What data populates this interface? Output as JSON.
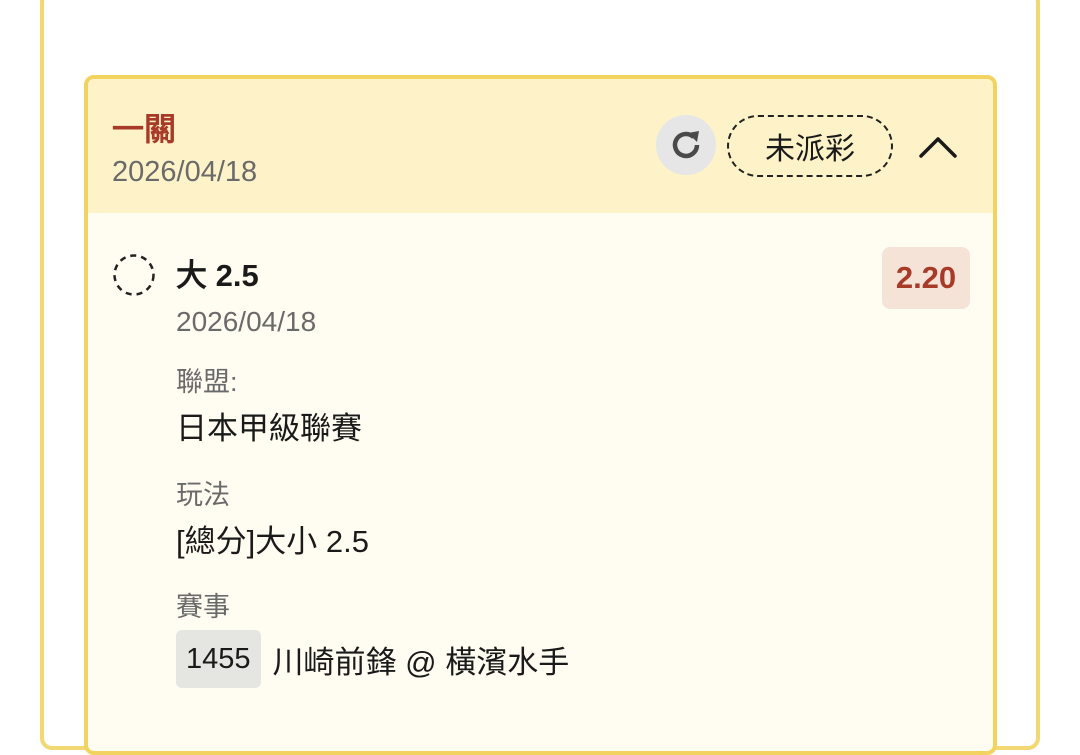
{
  "bet": {
    "type": "一關",
    "date": "2026/04/18",
    "status": "未派彩",
    "refresh_icon": "refresh-icon",
    "collapse_icon": "chevron-up-icon"
  },
  "selection": {
    "name": "大 2.5",
    "date": "2026/04/18",
    "odds": "2.20",
    "radio_icon": "dashed-circle-icon"
  },
  "details": {
    "league_label": "聯盟:",
    "league_value": "日本甲級聯賽",
    "play_label": "玩法",
    "play_value": "[總分]大小 2.5",
    "match_label": "賽事",
    "match_id": "1455",
    "match_teams": "川崎前鋒 @ 橫濱水手"
  },
  "colors": {
    "accent_red": "#a83a28",
    "card_border": "#f2d35f",
    "header_bg": "#fdf2c8",
    "card_bg": "#fffdf2"
  }
}
